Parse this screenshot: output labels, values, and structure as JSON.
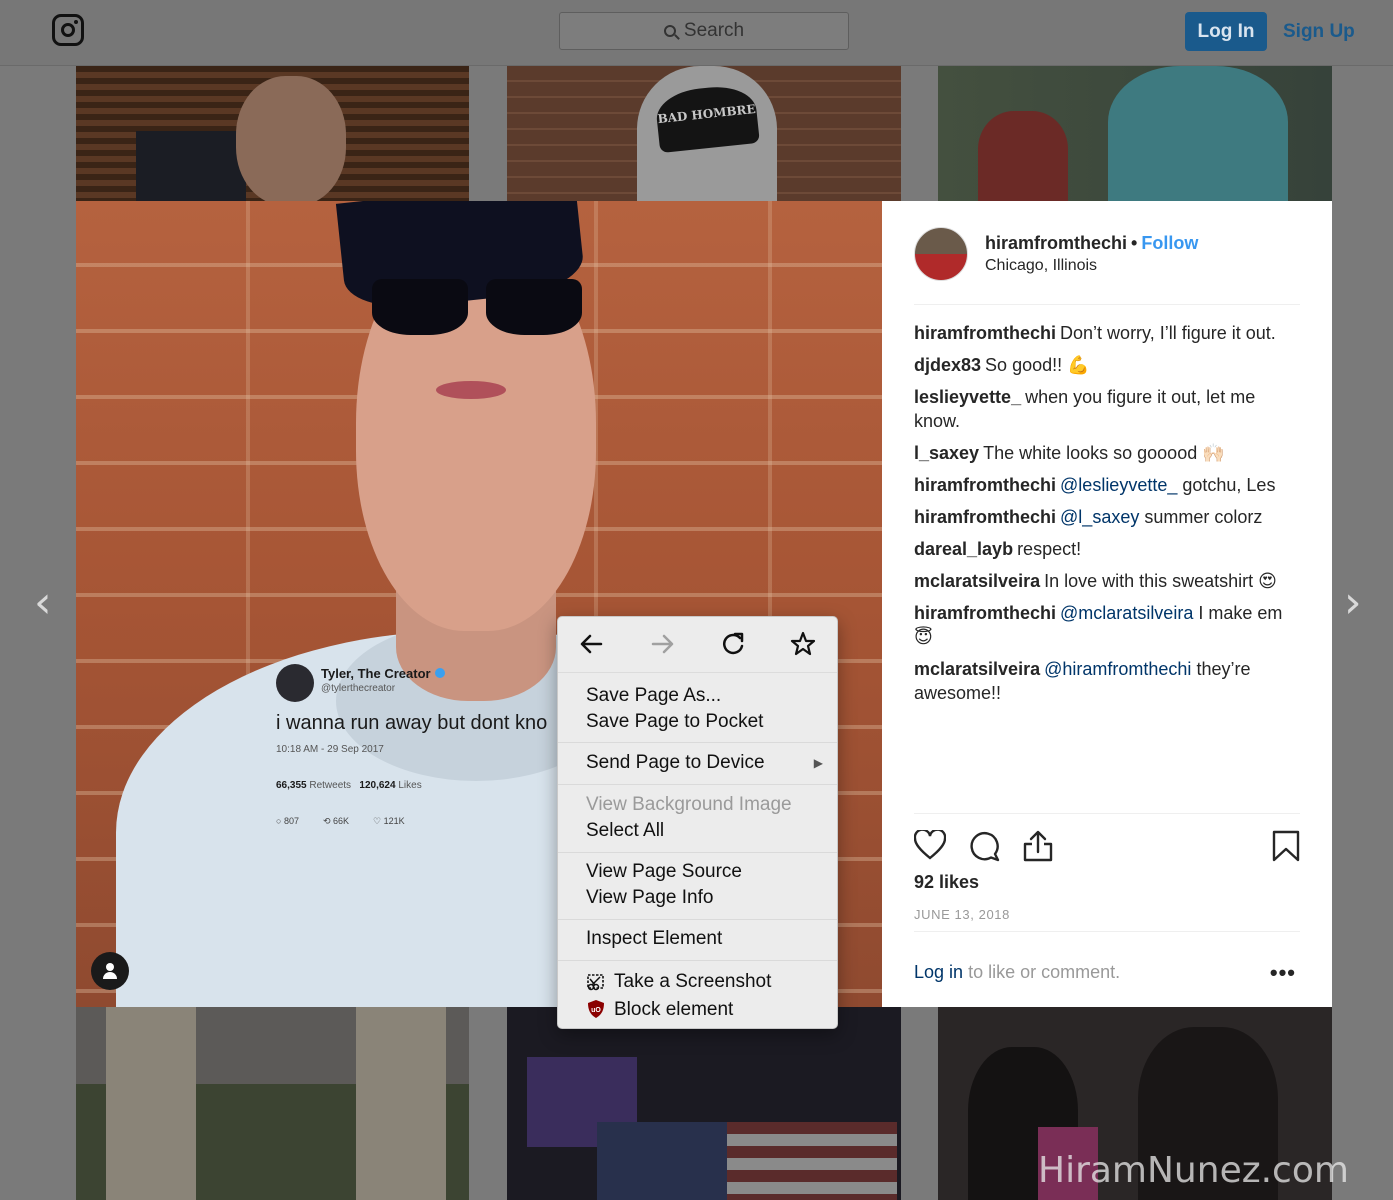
{
  "topbar": {
    "search_placeholder": "Search",
    "login_label": "Log In",
    "signup_label": "Sign Up"
  },
  "tiles": {
    "cap_text": "BAD HOMBRE"
  },
  "post": {
    "username": "hiramfromthechi",
    "follow_label": "Follow",
    "separator": "•",
    "location": "Chicago, Illinois",
    "comments": [
      {
        "user": "hiramfromthechi",
        "mention": "",
        "text": "Don’t worry, I’ll figure it out."
      },
      {
        "user": "djdex83",
        "mention": "",
        "text": "So good!! 💪"
      },
      {
        "user": "leslieyvette_",
        "mention": "",
        "text": "when you figure it out, let me know."
      },
      {
        "user": "l_saxey",
        "mention": "",
        "text": "The white looks so gooood 🙌🏻"
      },
      {
        "user": "hiramfromthechi",
        "mention": "@leslieyvette_",
        "text": "gotchu, Les"
      },
      {
        "user": "hiramfromthechi",
        "mention": "@l_saxey",
        "text": "summer colorz"
      },
      {
        "user": "dareal_layb",
        "mention": "",
        "text": "respect!"
      },
      {
        "user": "mclaratsilveira",
        "mention": "",
        "text": "In love with this sweatshirt 😍"
      },
      {
        "user": "hiramfromthechi",
        "mention": "@mclaratsilveira",
        "text": "I make em 😇"
      },
      {
        "user": "mclaratsilveira",
        "mention": "@hiramfromthechi",
        "text": "they’re awesome!!"
      }
    ],
    "likes": "92 likes",
    "date": "JUNE 13, 2018",
    "login_link": "Log in",
    "login_rest": "to like or comment.",
    "more": "•••"
  },
  "tweet": {
    "name": "Tyler, The Creator",
    "handle": "@tylerthecreator",
    "text": "i wanna run away but dont kno",
    "time": "10:18 AM - 29 Sep 2017",
    "retweets": "66,355",
    "retweets_label": "Retweets",
    "likes": "120,624",
    "likes_label": "Likes",
    "replies_count": "807",
    "retweet_count": "66K",
    "like_count": "121K"
  },
  "context_menu": {
    "items": [
      {
        "label": "Save Page As...",
        "disabled": false
      },
      {
        "label": "Save Page to Pocket",
        "disabled": false
      },
      {
        "label": "Send Page to Device",
        "disabled": false,
        "submenu": true
      },
      {
        "label": "View Background Image",
        "disabled": true
      },
      {
        "label": "Select All",
        "disabled": false
      },
      {
        "label": "View Page Source",
        "disabled": false
      },
      {
        "label": "View Page Info",
        "disabled": false
      },
      {
        "label": "Inspect Element",
        "disabled": false
      },
      {
        "label": "Take a Screenshot",
        "disabled": false
      },
      {
        "label": "Block element",
        "disabled": false
      }
    ],
    "submenu_arrow": "▶"
  },
  "nav": {
    "prev_arrow": "‹",
    "next_arrow": "›"
  },
  "watermark": "HiramNunez.com",
  "colors": {
    "accent": "#3897f0",
    "link": "#003569",
    "login_button": "#1a5a8c"
  },
  "icons": [
    "instagram-logo-icon",
    "search-icon",
    "heart-icon",
    "comment-icon",
    "share-icon",
    "bookmark-icon",
    "back-arrow-icon",
    "forward-arrow-icon",
    "reload-icon",
    "bookmark-star-icon",
    "screenshot-icon",
    "ublock-icon",
    "user-tag-icon"
  ]
}
